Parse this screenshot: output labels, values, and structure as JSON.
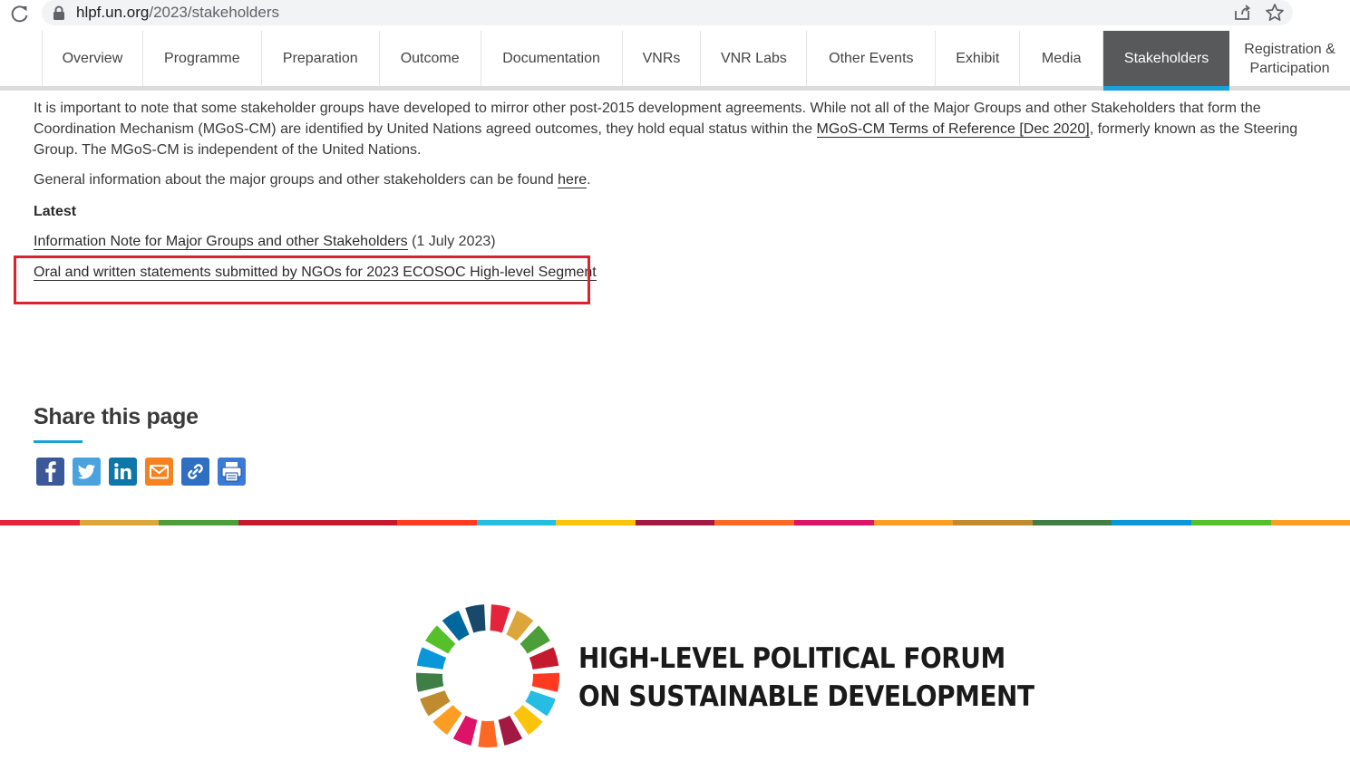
{
  "browser": {
    "url_host": "hlpf.un.org",
    "url_path": "/2023/stakeholders"
  },
  "nav": {
    "items": [
      {
        "label": "Overview",
        "width": 111
      },
      {
        "label": "Programme",
        "width": 131
      },
      {
        "label": "Preparation",
        "width": 130
      },
      {
        "label": "Outcome",
        "width": 112
      },
      {
        "label": "Documentation",
        "width": 156
      },
      {
        "label": "VNRs",
        "width": 87
      },
      {
        "label": "VNR Labs",
        "width": 117
      },
      {
        "label": "Other Events",
        "width": 142
      },
      {
        "label": "Exhibit",
        "width": 93
      },
      {
        "label": "Media",
        "width": 92
      },
      {
        "label": "Stakeholders",
        "width": 139,
        "active": true
      },
      {
        "label_line1": "Registration &",
        "label_line2": "Participation",
        "width": 133
      }
    ]
  },
  "content": {
    "para1_a": "It is important to note that some stakeholder groups have developed to mirror other post-2015 development agreements. While not all of the Major Groups and other Stakeholders that form the Coordination Mechanism (MGoS-CM) are identified by United Nations agreed outcomes, they hold equal status within the ",
    "para1_link": "MGoS-CM Terms of Reference [Dec 2020]",
    "para1_b": ", formerly known as the Steering Group. The MGoS-CM is independent of the United Nations.",
    "para2_a": "General information about the major groups and other stakeholders can be found ",
    "para2_link": "here",
    "para2_b": ".",
    "latest_heading": "Latest",
    "info_note_link": "Information Note for Major Groups and other Stakeholders",
    "info_note_date": " (1 July 2023)",
    "oral_link": "Oral and written statements submitted by NGOs for 2023 ECOSOC High-level Segment"
  },
  "share": {
    "heading": "Share this page",
    "icons": [
      "facebook-icon",
      "twitter-icon",
      "linkedin-icon",
      "email-icon",
      "copy-link-icon",
      "print-icon"
    ]
  },
  "footer": {
    "title_line1": "HIGH-LEVEL POLITICAL FORUM",
    "title_line2": "ON SUSTAINABLE DEVELOPMENT"
  },
  "colors": {
    "accent": "#19a1d8",
    "nav_active_bg": "#58595b",
    "highlight": "#d9232e",
    "sdg": [
      "#e5243b",
      "#dda63a",
      "#4c9f38",
      "#c5192d",
      "#ff3a21",
      "#26bde2",
      "#fcc30b",
      "#a21942",
      "#fd6925",
      "#dd1367",
      "#fd9d24",
      "#bf8b2e",
      "#3f7e44",
      "#0a97d9",
      "#56c02b",
      "#00689d",
      "#19486a"
    ]
  }
}
